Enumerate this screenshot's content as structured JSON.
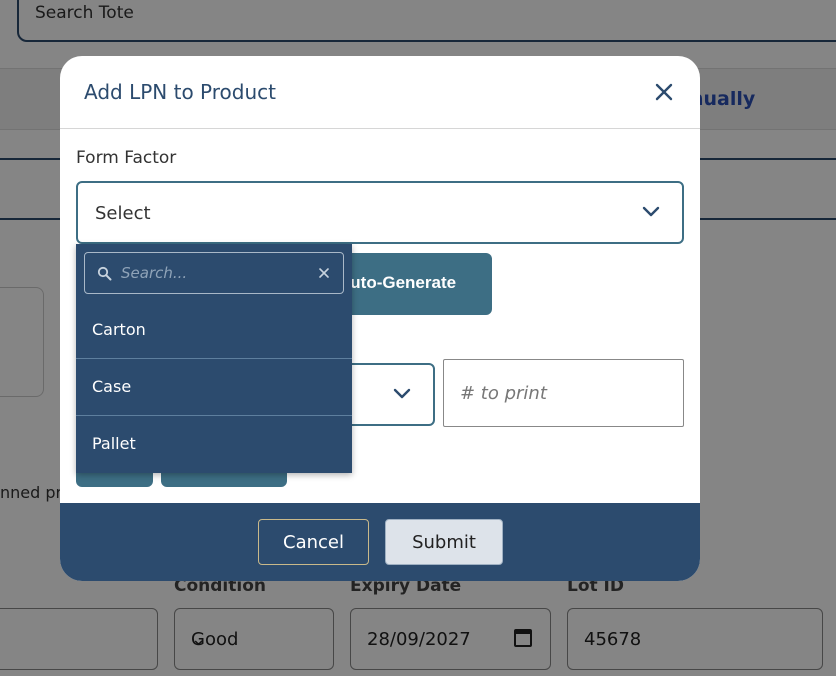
{
  "background": {
    "search_tote": "Search Tote",
    "manually_text": "nually",
    "scanned_text": "nned pro",
    "labels": {
      "condition": "Condition",
      "expiry_date": "Expiry Date",
      "lot_id": "Lot ID"
    },
    "values": {
      "condition": "Good",
      "expiry_date": "28/09/2027",
      "lot_id": "45678"
    }
  },
  "modal": {
    "title": "Add LPN to Product",
    "form_factor_label": "Form Factor",
    "form_factor_value": "Select",
    "autogen_label": "Auto-Generate",
    "print_placeholder": "# to print",
    "cancel_label": "Cancel",
    "submit_label": "Submit"
  },
  "dropdown": {
    "search_placeholder": "Search...",
    "options": [
      "Carton",
      "Case",
      "Pallet"
    ]
  },
  "colors": {
    "primary": "#2c4b6e",
    "accent": "#3d6e84",
    "link": "#2b4fb5"
  }
}
